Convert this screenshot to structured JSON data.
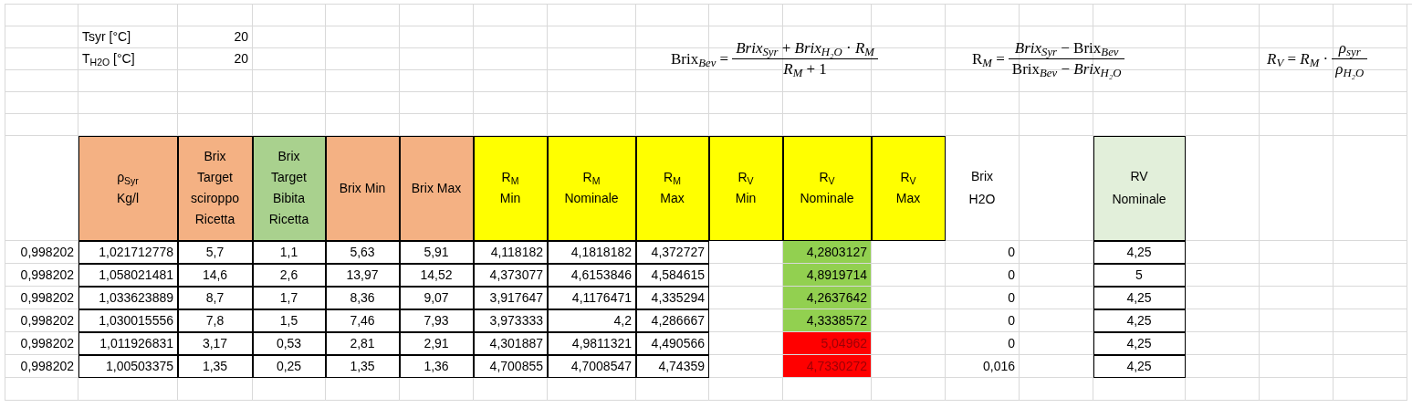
{
  "params": [
    {
      "label": "Tsyr [°C]",
      "value": "20"
    },
    {
      "label": "T$_{H2O}$ [°C]",
      "value": "20"
    }
  ],
  "formulas": [
    {
      "lhs": "Brix$_{Bev}$ =",
      "numerator": "*Brix*$_{Syr}$ + *Brix*$_{H₂O}$ · *R*$_{M}$",
      "denominator": "*R*$_{M}$ + 1"
    },
    {
      "lhs": "R$_{M}$ =",
      "numerator": "*Brix*$_{Syr}$ − Brix$_{Bev}$",
      "denominator": "Brix$_{Bev}$ − *Brix*$_{H₂O}$"
    },
    {
      "lhs": "*R*$_{V}$ = *R*$_{M}$ ·",
      "numerator": "*ρ*$_{syr}$",
      "denominator": "*ρ*$_{H₂O}$"
    }
  ],
  "table": {
    "columns": [
      {
        "lines": [
          "ρ$_{Syr}$",
          "Kg/l"
        ],
        "color": "#f4b183"
      },
      {
        "lines": [
          "Brix",
          "Target",
          "sciroppo",
          "Ricetta"
        ],
        "color": "#f4b183"
      },
      {
        "lines": [
          "Brix",
          "Target",
          "Bibita",
          "Ricetta"
        ],
        "color": "#a9d18e"
      },
      {
        "lines": [
          "Brix Min"
        ],
        "color": "#f4b183"
      },
      {
        "lines": [
          "Brix Max"
        ],
        "color": "#f4b183"
      },
      {
        "lines": [
          "R$_{M}$",
          "Min"
        ],
        "color": "#ffff00"
      },
      {
        "lines": [
          "R$_{M}$",
          "Nominale"
        ],
        "color": "#ffff00"
      },
      {
        "lines": [
          "R$_{M}$",
          "Max"
        ],
        "color": "#ffff00"
      },
      {
        "lines": [
          "R$_{V}$",
          "Min"
        ],
        "color": "#ffff00"
      },
      {
        "lines": [
          "R$_{V}$",
          "Nominale"
        ],
        "color": "#ffff00"
      },
      {
        "lines": [
          "R$_{V}$",
          "Max"
        ],
        "color": "#ffff00"
      }
    ],
    "brix_h2o_header": [
      "Brix",
      "H2O"
    ],
    "rv_header": {
      "lines": [
        "RV",
        "Nominale"
      ],
      "color": "#e2efda"
    },
    "rows": [
      {
        "column_a": "0,998202",
        "cells": [
          "1,021712778",
          "5,7",
          "1,1",
          "5,63",
          "5,91",
          "4,118182",
          "4,1818182",
          "4,372727"
        ],
        "rv_nominale_calc": {
          "value": "4,2803127",
          "color": "#92d050",
          "alert": false
        },
        "brix_h2o": "0",
        "rv_nominale": "4,25"
      },
      {
        "column_a": "0,998202",
        "cells": [
          "1,058021481",
          "14,6",
          "2,6",
          "13,97",
          "14,52",
          "4,373077",
          "4,6153846",
          "4,584615"
        ],
        "rv_nominale_calc": {
          "value": "4,8919714",
          "color": "#92d050",
          "alert": false
        },
        "brix_h2o": "0",
        "rv_nominale": "5"
      },
      {
        "column_a": "0,998202",
        "cells": [
          "1,033623889",
          "8,7",
          "1,7",
          "8,36",
          "9,07",
          "3,917647",
          "4,1176471",
          "4,335294"
        ],
        "rv_nominale_calc": {
          "value": "4,2637642",
          "color": "#92d050",
          "alert": false
        },
        "brix_h2o": "0",
        "rv_nominale": "4,25"
      },
      {
        "column_a": "0,998202",
        "cells": [
          "1,030015556",
          "7,8",
          "1,5",
          "7,46",
          "7,93",
          "3,973333",
          "4,2",
          "4,286667"
        ],
        "rv_nominale_calc": {
          "value": "4,3338572",
          "color": "#92d050",
          "alert": false
        },
        "brix_h2o": "0",
        "rv_nominale": "4,25"
      },
      {
        "column_a": "0,998202",
        "cells": [
          "1,011926831",
          "3,17",
          "0,53",
          "2,81",
          "2,91",
          "4,301887",
          "4,9811321",
          "4,490566"
        ],
        "rv_nominale_calc": {
          "value": "5,04962",
          "color": "#ff0000",
          "alert": true
        },
        "brix_h2o": "0",
        "rv_nominale": "4,25"
      },
      {
        "column_a": "0,998202",
        "cells": [
          "1,00503375",
          "1,35",
          "0,25",
          "1,35",
          "1,36",
          "4,700855",
          "4,7008547",
          "4,74359"
        ],
        "rv_nominale_calc": {
          "value": "4,7330272",
          "color": "#ff0000",
          "alert": true
        },
        "brix_h2o": "0,016",
        "rv_nominale": "4,25"
      }
    ]
  }
}
